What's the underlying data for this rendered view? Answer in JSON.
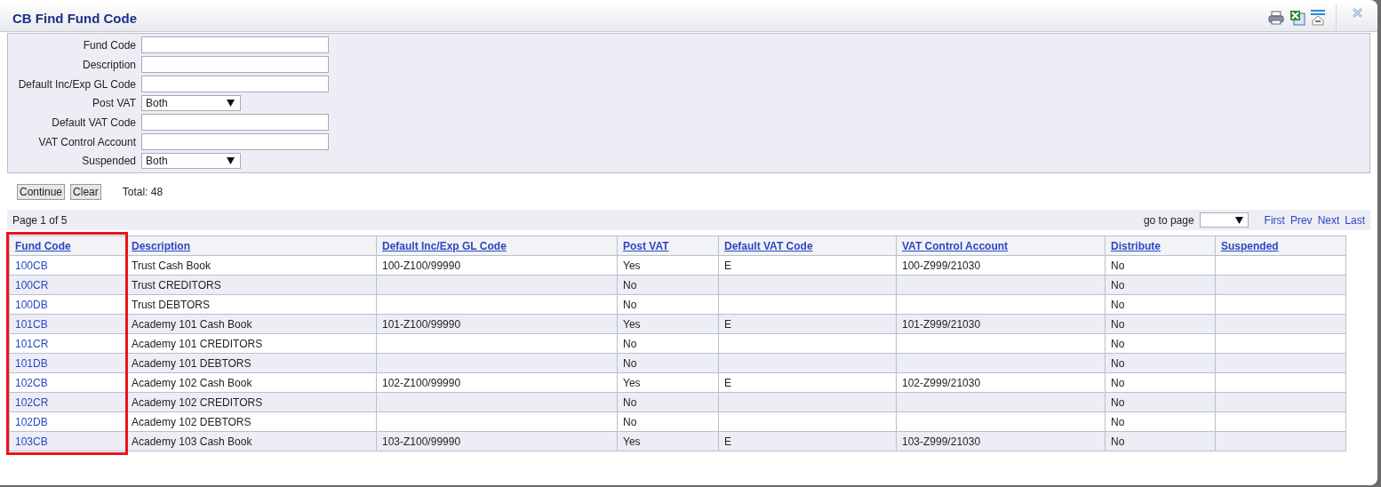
{
  "window": {
    "title": "CB Find Fund Code"
  },
  "filters": [
    {
      "label": "Fund Code",
      "kind": "text"
    },
    {
      "label": "Description",
      "kind": "text"
    },
    {
      "label": "Default Inc/Exp GL Code",
      "kind": "text"
    },
    {
      "label": "Post VAT",
      "kind": "select",
      "value": "Both"
    },
    {
      "label": "Default VAT Code",
      "kind": "text"
    },
    {
      "label": "VAT Control Account",
      "kind": "text"
    },
    {
      "label": "Suspended",
      "kind": "select",
      "value": "Both"
    }
  ],
  "buttons": [
    "Continue",
    "Clear"
  ],
  "total": "Total: 48",
  "pager": {
    "page": "Page 1 of 5",
    "goto_label": "go to page",
    "links": [
      "First",
      "Prev",
      "Next",
      "Last"
    ]
  },
  "table": {
    "columns": [
      {
        "label": "Fund Code",
        "highlighted": true
      },
      {
        "label": "Description",
        "highlighted": false
      },
      {
        "label": "Default Inc/Exp GL Code",
        "highlighted": false
      },
      {
        "label": "Post VAT",
        "highlighted": false
      },
      {
        "label": "Default VAT Code",
        "highlighted": false
      },
      {
        "label": "VAT Control Account",
        "highlighted": false
      },
      {
        "label": "Distribute",
        "highlighted": false
      },
      {
        "label": "Suspended",
        "highlighted": false
      }
    ],
    "rows": [
      [
        "100CB",
        "Trust Cash Book",
        "100-Z100/99990",
        "Yes",
        "E",
        "100-Z999/21030",
        "No",
        ""
      ],
      [
        "100CR",
        "Trust CREDITORS",
        "",
        "No",
        "",
        "",
        "No",
        ""
      ],
      [
        "100DB",
        "Trust DEBTORS",
        "",
        "No",
        "",
        "",
        "No",
        ""
      ],
      [
        "101CB",
        "Academy 101 Cash Book",
        "101-Z100/99990",
        "Yes",
        "E",
        "101-Z999/21030",
        "No",
        ""
      ],
      [
        "101CR",
        "Academy 101 CREDITORS",
        "",
        "No",
        "",
        "",
        "No",
        ""
      ],
      [
        "101DB",
        "Academy 101 DEBTORS",
        "",
        "No",
        "",
        "",
        "No",
        ""
      ],
      [
        "102CB",
        "Academy 102 Cash Book",
        "102-Z100/99990",
        "Yes",
        "E",
        "102-Z999/21030",
        "No",
        ""
      ],
      [
        "102CR",
        "Academy 102 CREDITORS",
        "",
        "No",
        "",
        "",
        "No",
        ""
      ],
      [
        "102DB",
        "Academy 102 DEBTORS",
        "",
        "No",
        "",
        "",
        "No",
        ""
      ],
      [
        "103CB",
        "Academy 103 Cash Book",
        "103-Z100/99990",
        "Yes",
        "E",
        "103-Z999/21030",
        "No",
        ""
      ]
    ]
  }
}
